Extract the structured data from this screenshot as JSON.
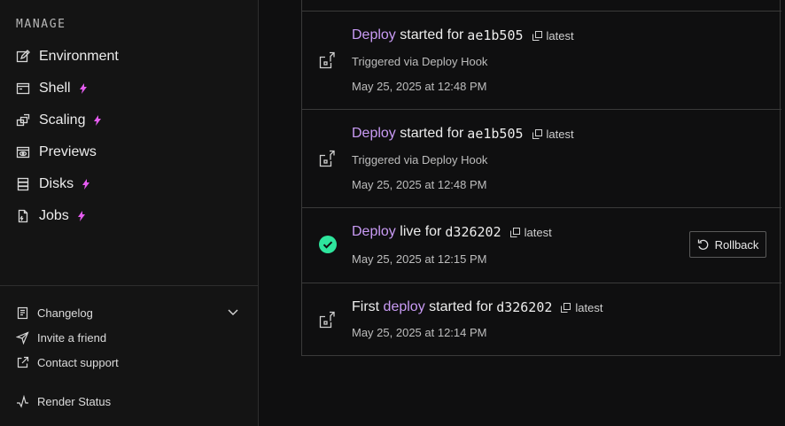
{
  "sidebar": {
    "section_title": "MANAGE",
    "items": [
      {
        "label": "Environment"
      },
      {
        "label": "Shell"
      },
      {
        "label": "Scaling"
      },
      {
        "label": "Previews"
      },
      {
        "label": "Disks"
      },
      {
        "label": "Jobs"
      }
    ],
    "footer": [
      {
        "label": "Changelog"
      },
      {
        "label": "Invite a friend"
      },
      {
        "label": "Contact support"
      },
      {
        "label": "Render Status"
      }
    ]
  },
  "events": [
    {
      "prefix": "",
      "link": "Deploy",
      "text": " started for",
      "commit": "ae1b505",
      "tag": "latest",
      "trigger": "Triggered via Deploy Hook",
      "time": "May 25, 2025 at 12:48 PM"
    },
    {
      "prefix": "",
      "link": "Deploy",
      "text": " started for",
      "commit": "ae1b505",
      "tag": "latest",
      "trigger": "Triggered via Deploy Hook",
      "time": "May 25, 2025 at 12:48 PM"
    },
    {
      "prefix": "",
      "link": "Deploy",
      "text": " live for",
      "commit": "d326202",
      "tag": "latest",
      "time": "May 25, 2025 at 12:15 PM",
      "action": "Rollback"
    },
    {
      "prefix": "First ",
      "link": "deploy",
      "text": " started for",
      "commit": "d326202",
      "tag": "latest",
      "time": "May 25, 2025 at 12:14 PM"
    }
  ],
  "colors": {
    "accent_link": "#c99bf5",
    "bolt": "#e55cf0",
    "success": "#2ee59d"
  }
}
